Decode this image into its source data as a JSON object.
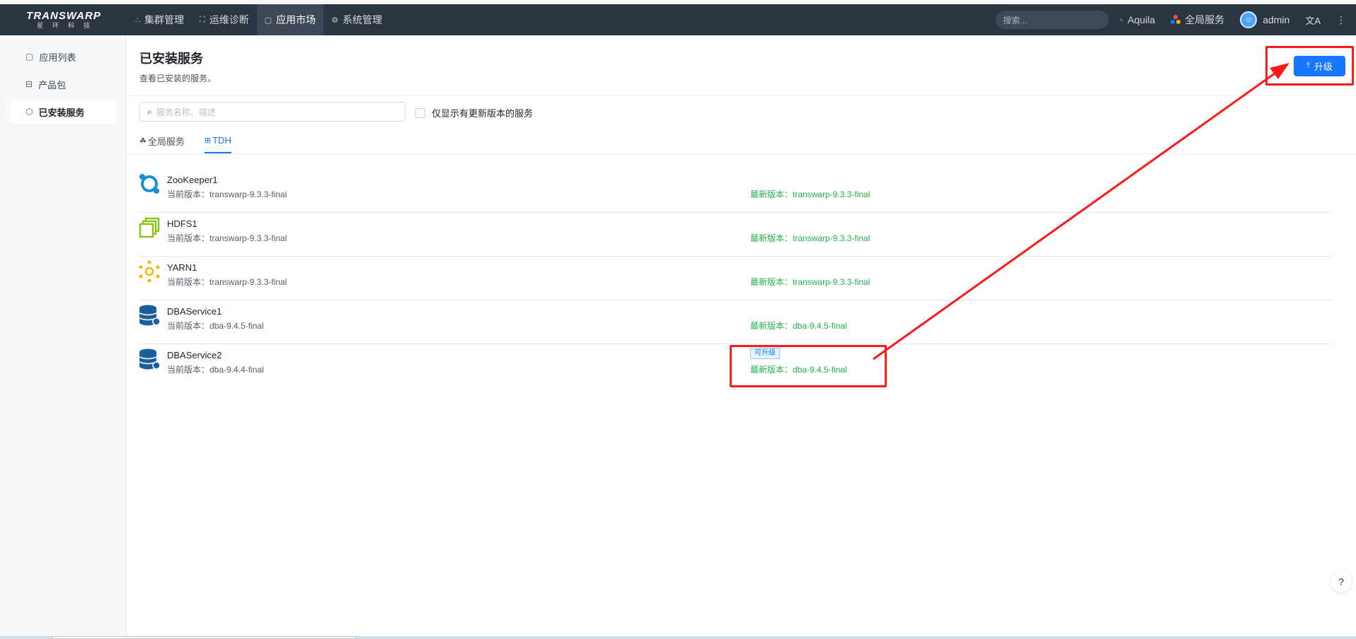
{
  "brand": {
    "name": "TRANSWARP",
    "subtitle": "星环科技"
  },
  "nav": {
    "items": [
      {
        "label": "集群管理",
        "icon": "cluster-icon"
      },
      {
        "label": "运维诊断",
        "icon": "diagnose-icon"
      },
      {
        "label": "应用市场",
        "icon": "market-icon",
        "active": true
      },
      {
        "label": "系统管理",
        "icon": "gear-icon"
      }
    ],
    "search_placeholder": "搜索...",
    "aquila": "Aquila",
    "global_services": "全局服务",
    "user": "admin"
  },
  "sidebar": {
    "items": [
      {
        "label": "应用列表",
        "icon": "app-list-icon"
      },
      {
        "label": "产品包",
        "icon": "package-icon"
      },
      {
        "label": "已安装服务",
        "icon": "installed-icon",
        "active": true
      }
    ]
  },
  "main": {
    "title": "已安装服务",
    "description": "查看已安装的服务。",
    "upgrade_button": "升级",
    "search_placeholder": "服务名称、描述",
    "filter_label": "仅显示有更新版本的服务",
    "tabs": [
      {
        "label": "全局服务",
        "icon": "global-service-icon"
      },
      {
        "label": "TDH",
        "icon": "tdh-icon",
        "active": true
      }
    ],
    "services": [
      {
        "name": "ZooKeeper1",
        "current": "当前版本：transwarp-9.3.3-final",
        "latest": "最新版本：transwarp-9.3.3-final",
        "icon": "zookeeper-icon"
      },
      {
        "name": "HDFS1",
        "current": "当前版本：transwarp-9.3.3-final",
        "latest": "最新版本：transwarp-9.3.3-final",
        "icon": "hdfs-icon"
      },
      {
        "name": "YARN1",
        "current": "当前版本：transwarp-9.3.3-final",
        "latest": "最新版本：transwarp-9.3.3-final",
        "icon": "yarn-icon"
      },
      {
        "name": "DBAService1",
        "current": "当前版本：dba-9.4.5-final",
        "latest": "最新版本：dba-9.4.5-final",
        "icon": "database-icon"
      },
      {
        "name": "DBAService2",
        "current": "当前版本：dba-9.4.4-final",
        "latest": "最新版本：dba-9.4.5-final",
        "icon": "database-icon",
        "tag": "可升级"
      }
    ]
  },
  "colors": {
    "nav_bg": "#2b3441",
    "primary": "#1677ff",
    "success": "#22b14c",
    "annotation": "#ff1a1a"
  }
}
